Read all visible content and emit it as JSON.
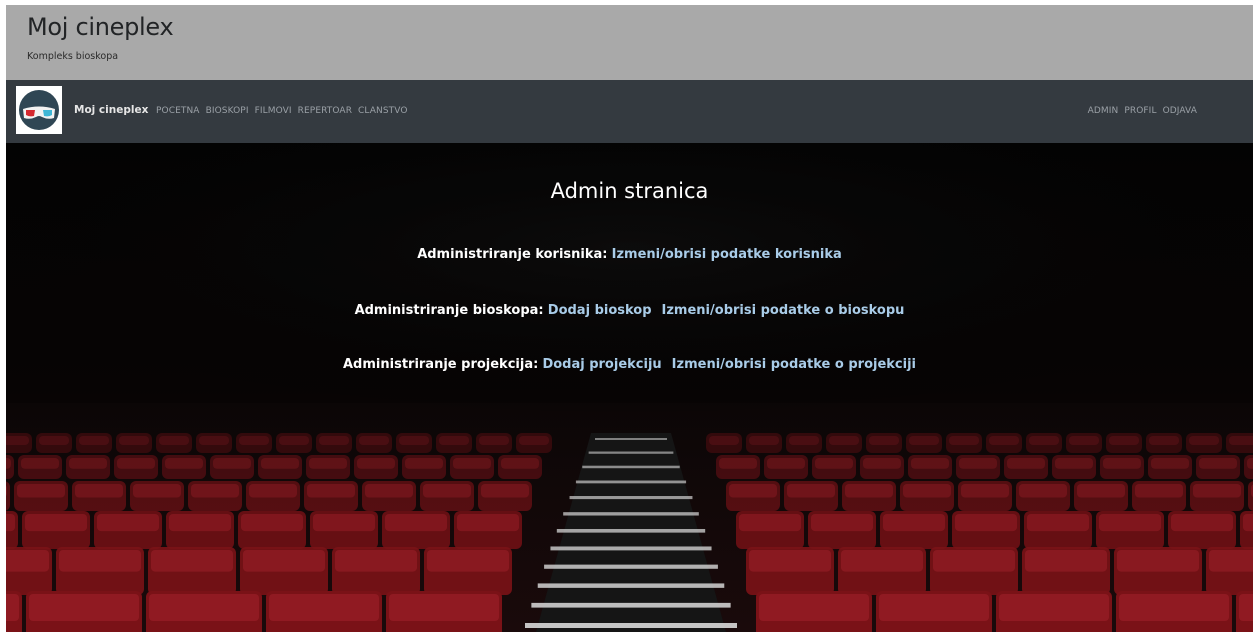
{
  "header": {
    "title": "Moj cineplex",
    "subtitle": "Kompleks bioskopa"
  },
  "navbar": {
    "brand": "Moj cineplex",
    "logo_icon": "3d-glasses-icon",
    "left_links": [
      "POCETNA",
      "BIOSKOPI",
      "FILMOVI",
      "REPERTOAR",
      "CLANSTVO"
    ],
    "right_links": [
      "ADMIN",
      "PROFIL",
      "ODJAVA"
    ]
  },
  "main": {
    "heading": "Admin stranica",
    "users": {
      "label": "Administriranje korisnika:",
      "links": [
        "Izmeni/obrisi podatke korisnika"
      ]
    },
    "cinemas": {
      "label": "Administriranje bioskopa:",
      "links": [
        "Dodaj bioskop",
        "Izmeni/obrisi podatke o bioskopu"
      ]
    },
    "screenings": {
      "label": "Administriranje projekcija:",
      "links": [
        "Dodaj projekciju",
        "Izmeni/obrisi podatke o projekciji"
      ]
    }
  },
  "colors": {
    "header_bg": "#a9a9a9",
    "navbar_bg": "#343a40",
    "link": "#a9cce8",
    "seat": "#7a1217"
  }
}
